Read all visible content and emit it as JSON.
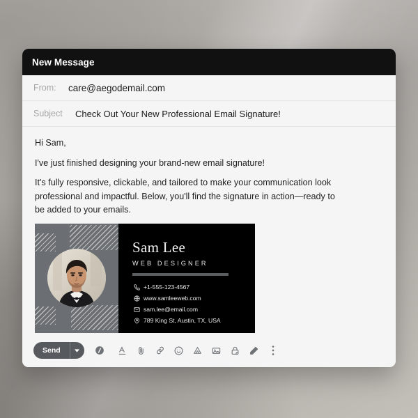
{
  "window": {
    "title": "New Message"
  },
  "compose": {
    "from": {
      "label": "From:",
      "value": "care@aegodemail.com"
    },
    "subject": {
      "label": "Subject",
      "value": "Check Out Your New Professional Email Signature!"
    },
    "body": {
      "greeting": "Hi Sam,",
      "line_1": "I've just finished designing your brand-new email signature!",
      "line_2": "It's fully responsive, clickable, and tailored to make your communication look professional and impactful. Below, you'll find the signature in action—ready to be added to your emails."
    }
  },
  "signature": {
    "name": "Sam Lee",
    "role": "WEB DESIGNER",
    "contacts": [
      {
        "icon": "phone-icon",
        "text": "+1-555-123-4567"
      },
      {
        "icon": "globe-icon",
        "text": "www.samleeweb.com"
      },
      {
        "icon": "envelope-icon",
        "text": "sam.lee@email.com"
      },
      {
        "icon": "location-pin-icon",
        "text": "789 King St, Austin, TX, USA"
      }
    ],
    "colors": {
      "card_background": "#000000",
      "photo_panel": "#6b6e72",
      "divider": "#5b5d60"
    }
  },
  "toolbar": {
    "send_label": "Send",
    "send_caret_icon": "chevron-down-icon",
    "icons": [
      "formatting-options-icon",
      "text-format-icon",
      "attach-file-icon",
      "insert-link-icon",
      "insert-emoji-icon",
      "insert-from-drive-icon",
      "insert-photo-icon",
      "confidential-mode-icon",
      "insert-signature-icon",
      "more-options-icon"
    ]
  },
  "theme": {
    "titlebar_background": "#111111",
    "window_background": "#f5f5f5",
    "send_button": "#565a5e",
    "label_gray": "#a6a6a6"
  }
}
